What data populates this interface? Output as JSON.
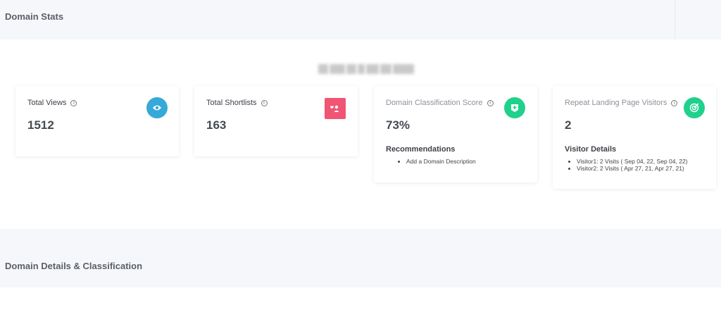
{
  "header": {
    "title": "Domain Stats"
  },
  "stats": [
    {
      "label": "Total Views",
      "value": "1512",
      "icon": "eye-icon",
      "color": "#35a9d8"
    },
    {
      "label": "Total Shortlists",
      "value": "163",
      "icon": "user-heart-icon",
      "color": "#f05573"
    },
    {
      "label": "Domain Classification Score",
      "value": "73%",
      "icon": "shield-badge-icon",
      "color": "#1fd18c",
      "sub_title": "Recommendations",
      "items": [
        "Add a Domain Description"
      ]
    },
    {
      "label": "Repeat Landing Page Visitors",
      "value": "2",
      "icon": "target-icon",
      "color": "#1fd18c",
      "sub_title": "Visitor Details",
      "items": [
        "Visitor1: 2 Visits ( Sep 04, 22, Sep 04, 22)",
        "Visitor2: 2 Visits ( Apr 27, 21, Apr 27, 21)"
      ]
    }
  ],
  "section2": {
    "title": "Domain Details & Classification"
  }
}
